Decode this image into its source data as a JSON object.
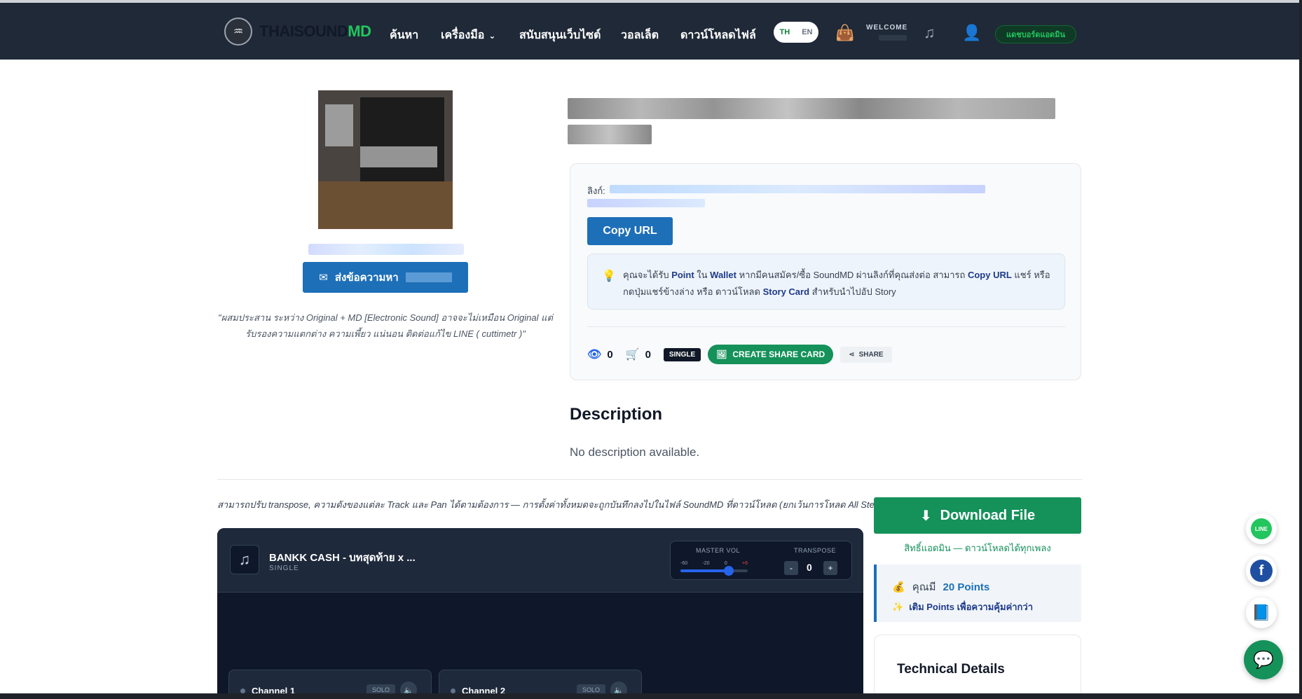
{
  "nav": {
    "logo_text_a": "THAISOUND",
    "logo_text_b": "MD",
    "items": [
      {
        "label": "ค้นหา"
      },
      {
        "label": "เครื่องมือ"
      },
      {
        "label": "สนับสนุนเว็บไซต์"
      },
      {
        "label": "วอลเล็ต"
      },
      {
        "label": "ดาวน์โหลดไฟล์"
      }
    ],
    "lang_th": "TH",
    "lang_en": "EN",
    "welcome": "WELCOME",
    "support_label": "แดชบอร์ดแอดมิน"
  },
  "profile": {
    "message_label": "ส่งข้อความหา",
    "quote": "\"ผสมประสาน ระหว่าง Original + MD [Electronic Sound] อาจจะไม่เหมือน Original แต่ รับรองความแตกต่าง ความเพี้ยว แน่นอน ติดต่อแก้ไข LINE ( cuttimetr )\""
  },
  "link_card": {
    "link_label": "ลิงก์:",
    "copy_label": "Copy URL",
    "tip_t1": "คุณจะได้รับ ",
    "tip_b1": "Point",
    "tip_t2": " ใน ",
    "tip_b2": "Wallet",
    "tip_t3": " หากมีคนสมัคร/ซื้อ SoundMD ผ่านลิงก์ที่คุณส่งต่อ สามารถ ",
    "tip_b3": "Copy URL",
    "tip_t4": " แชร์ หรือกดปุ่มแชร์ข้างล่าง หรือ ดาวน์โหลด ",
    "tip_b4": "Story Card",
    "tip_t5": " สำหรับนำไปอัป Story",
    "views": "0",
    "cart": "0",
    "type_badge": "SINGLE",
    "share_card_label": "CREATE SHARE CARD",
    "share_label": "SHARE"
  },
  "description": {
    "title": "Description",
    "text": "No description available."
  },
  "transpose_note": "สามารถปรับ transpose, ความดังของแต่ละ Track และ Pan ได้ตามต้องการ — การตั้งค่าทั้งหมดจะถูกบันทึกลงไปในไฟล์ SoundMD ที่ดาวน์โหลด (ยกเว้นการโหลด All Stems)",
  "player": {
    "track_title": "BANKK CASH - บทสุดท้าย x ...",
    "track_type": "SINGLE",
    "master_vol_label": "MASTER VOL",
    "master_vol_level": 0.72,
    "ticks": [
      "-60",
      "-20",
      "0",
      "+6"
    ],
    "transpose_label": "TRANSPOSE",
    "transpose_value": "0",
    "minus": "-",
    "plus": "+",
    "channels": [
      {
        "name": "Channel 1",
        "solo": "SOLO"
      },
      {
        "name": "Channel 2",
        "solo": "SOLO"
      }
    ]
  },
  "download": {
    "button_label": "Download File",
    "note": "สิทธิ์แอดมิน — ดาวน์โหลดได้ทุกเพลง",
    "points_prefix": "คุณมี",
    "points_value": "20 Points",
    "topup_t1": "เติม ",
    "topup_b": "Points",
    "topup_t2": " เพื่อความคุ้มค่ากว่า"
  },
  "technical": {
    "title": "Technical Details"
  },
  "floating": {
    "line_label": "LINE",
    "fb_label": "f"
  },
  "colors": {
    "nav_bg": "#1f2937",
    "brand_green": "#15915a",
    "brand_blue": "#1d6fb8",
    "player_bg": "#0f172a"
  }
}
